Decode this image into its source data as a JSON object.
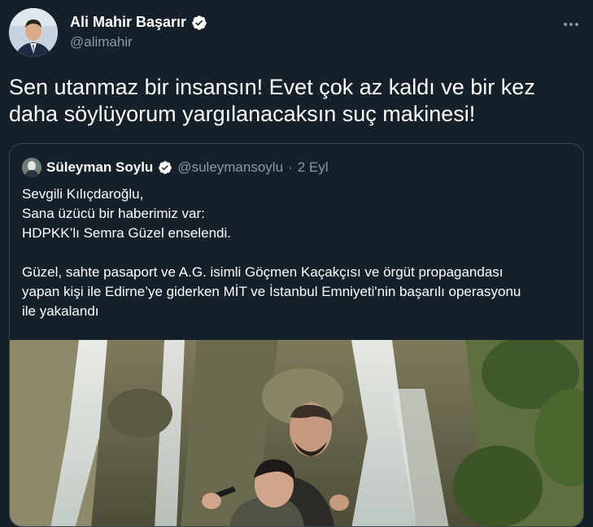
{
  "tweet": {
    "author_name": "Ali Mahir Başarır",
    "author_handle": "@alimahir",
    "text": "Sen utanmaz bir insansın! Evet çok az kaldı ve bir kez daha söylüyorum yargılanacaksın suç makinesi!",
    "avatar_icon": "profile-photo",
    "verified_icon": "verified-badge-icon",
    "more_icon": "more-options-icon"
  },
  "quote": {
    "author_name": "Süleyman Soylu",
    "author_handle": "@suleymansoylu",
    "separator": "·",
    "date": "2 Eyl",
    "lines": [
      "Sevgili Kılıçdaroğlu,",
      "Sana üzücü bir haberimiz var:",
      "HDPKK’lı Semra Güzel enselendi.",
      "Güzel, sahte pasaport ve A.G. isimli Göçmen Kaçakçısı ve örgüt propagandası",
      "yapan kişi ile Edirne’ye giderken MİT ve İstanbul Emniyeti'nin başarılı operasyonu",
      "ile yakalandı"
    ]
  },
  "colors": {
    "background": "#15202b",
    "border": "#38444d",
    "secondary_text": "#8b98a5",
    "verified": "#ffffff"
  }
}
